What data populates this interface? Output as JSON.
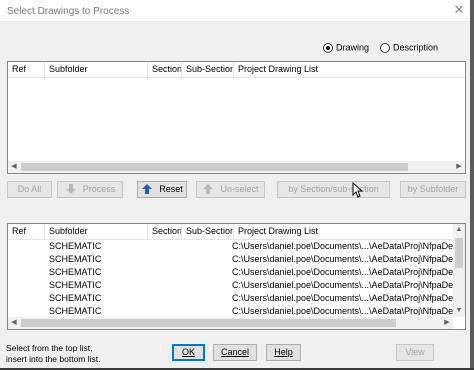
{
  "window": {
    "title": "Select Drawings to Process"
  },
  "view_mode": {
    "options": [
      "Drawing",
      "Description"
    ],
    "selected": "Drawing"
  },
  "columns": [
    "Ref",
    "Subfolder",
    "Section",
    "Sub-Section",
    "Project Drawing List"
  ],
  "buttons": {
    "do_all": "Do All",
    "process": "Process",
    "reset": "Reset",
    "unselect": "Un-select",
    "by_section": "by Section/sub-section",
    "by_subfolder": "by Subfolder",
    "ok": "OK",
    "cancel": "Cancel",
    "help": "Help",
    "view": "View"
  },
  "bottom_rows": [
    {
      "ref": "",
      "subfolder": "SCHEMATIC",
      "section": "",
      "subsection": "",
      "path": "C:\\Users\\daniel.poe\\Documents\\...\\AeData\\Proj\\NfpaDemo\\de"
    },
    {
      "ref": "",
      "subfolder": "SCHEMATIC",
      "section": "",
      "subsection": "",
      "path": "C:\\Users\\daniel.poe\\Documents\\...\\AeData\\Proj\\NfpaDemo\\de"
    },
    {
      "ref": "",
      "subfolder": "SCHEMATIC",
      "section": "",
      "subsection": "",
      "path": "C:\\Users\\daniel.poe\\Documents\\...\\AeData\\Proj\\NfpaDemo\\de"
    },
    {
      "ref": "",
      "subfolder": "SCHEMATIC",
      "section": "",
      "subsection": "",
      "path": "C:\\Users\\daniel.poe\\Documents\\...\\AeData\\Proj\\NfpaDemo\\de"
    },
    {
      "ref": "",
      "subfolder": "SCHEMATIC",
      "section": "",
      "subsection": "",
      "path": "C:\\Users\\daniel.poe\\Documents\\...\\AeData\\Proj\\NfpaDemo\\de"
    },
    {
      "ref": "",
      "subfolder": "SCHEMATIC",
      "section": "",
      "subsection": "",
      "path": "C:\\Users\\daniel.poe\\Documents\\...\\AeData\\Proj\\NfpaDemo\\de"
    }
  ],
  "status": {
    "line1": "Select from the top list,",
    "line2": "insert into the bottom list."
  },
  "icons": {
    "close": "close-icon",
    "process": "arrow-down-icon",
    "reset": "arrow-up-icon",
    "unselect": "arrow-up-icon"
  },
  "colors": {
    "accent": "#0078d7",
    "reset_arrow": "#1a5fb4",
    "disabled_text": "#a0a0a0"
  }
}
